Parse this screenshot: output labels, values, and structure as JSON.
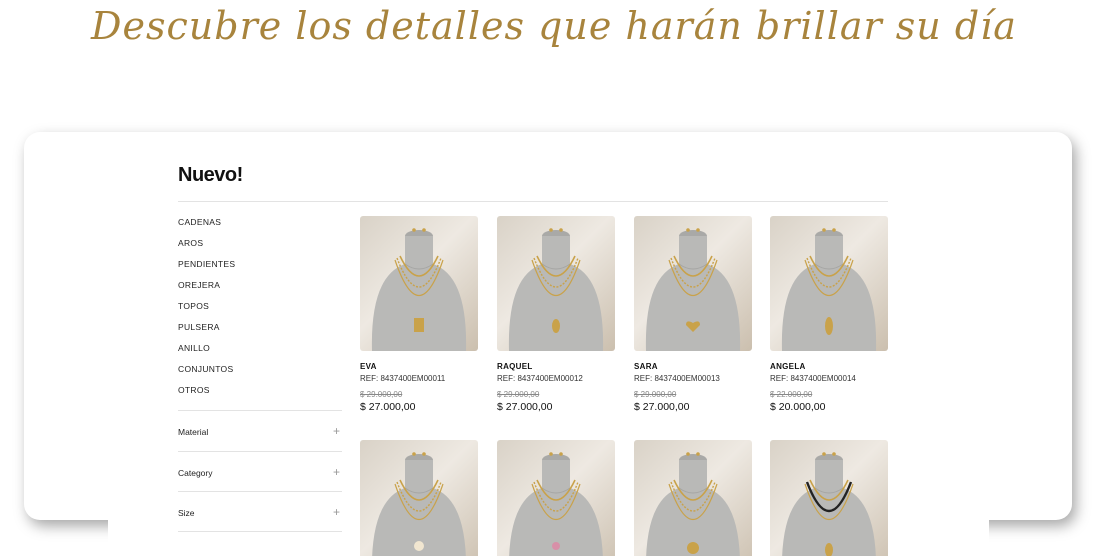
{
  "headline": "Descubre los detalles que harán brillar su día",
  "page_title": "Nuevo!",
  "categories": [
    "CADENAS",
    "AROS",
    "PENDIENTES",
    "OREJERA",
    "TOPOS",
    "PULSERA",
    "ANILLO",
    "CONJUNTOS",
    "OTROS"
  ],
  "filters": [
    {
      "label": "Material",
      "icon": "plus-icon"
    },
    {
      "label": "Category",
      "icon": "plus-icon"
    },
    {
      "label": "Size",
      "icon": "plus-icon"
    }
  ],
  "products": [
    {
      "name": "EVA",
      "ref": "REF: 8437400EM00011",
      "old_price": "$ 29.000,00",
      "price": "$ 27.000,00"
    },
    {
      "name": "RAQUEL",
      "ref": "REF: 8437400EM00012",
      "old_price": "$ 29.000,00",
      "price": "$ 27.000,00"
    },
    {
      "name": "SARA",
      "ref": "REF: 8437400EM00013",
      "old_price": "$ 29.000,00",
      "price": "$ 27.000,00"
    },
    {
      "name": "ANGELA",
      "ref": "REF: 8437400EM00014",
      "old_price": "$ 22.000,00",
      "price": "$ 20.000,00"
    }
  ],
  "colors": {
    "headline": "#a8843d",
    "gold": "#c9a24a",
    "bust": "#b9b9b7"
  }
}
